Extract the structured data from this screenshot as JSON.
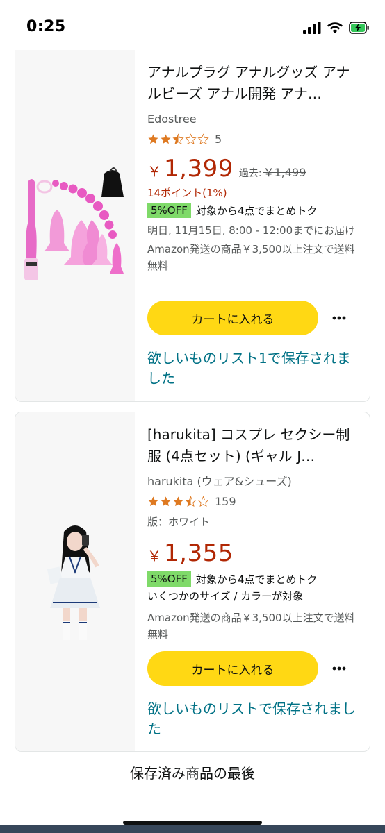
{
  "status": {
    "time": "0:25"
  },
  "items": [
    {
      "title": "アナルプラグ アナルグッズ アナルビーズ アナル開発 アナ…",
      "brand": "Edostree",
      "rating": 2.5,
      "rating_count": "5",
      "currency": "￥",
      "price": "1,399",
      "was_label": "過去:",
      "was_price": "￥1,499",
      "points": "14ポイント(1%)",
      "promo_badge": "5%OFF",
      "promo_text": "対象から4点でまとめトク",
      "delivery": "明日, 11月15日, 8:00 - 12:00までにお届け",
      "shipping": "Amazon発送の商品￥3,500以上注文で送料無料",
      "cart_label": "カートに入れる",
      "wishlist_text": "欲しいものリスト1で保存されました",
      "thumb_icon": "pink-toy-set-image"
    },
    {
      "title": "[harukita] コスプレ セクシー制服 (4点セット) (ギャル J…",
      "brand": "harukita (ウェア&シューズ)",
      "rating": 3.5,
      "rating_count": "159",
      "variant": "版：ホワイト",
      "currency": "￥",
      "price": "1,355",
      "promo_badge": "5%OFF",
      "promo_text": "対象から4点でまとめトク",
      "promo_sub": "いくつかのサイズ / カラーが対象",
      "shipping": "Amazon発送の商品￥3,500以上注文で送料無料",
      "cart_label": "カートに入れる",
      "wishlist_text": "欲しいものリストで保存されました",
      "thumb_icon": "cosplay-uniform-image"
    }
  ],
  "footer": {
    "end_text": "保存済み商品の最後"
  },
  "colors": {
    "price": "#b12704",
    "link": "#007185",
    "cart_button": "#ffd814",
    "badge": "#7fda69",
    "star": "#de7921"
  }
}
